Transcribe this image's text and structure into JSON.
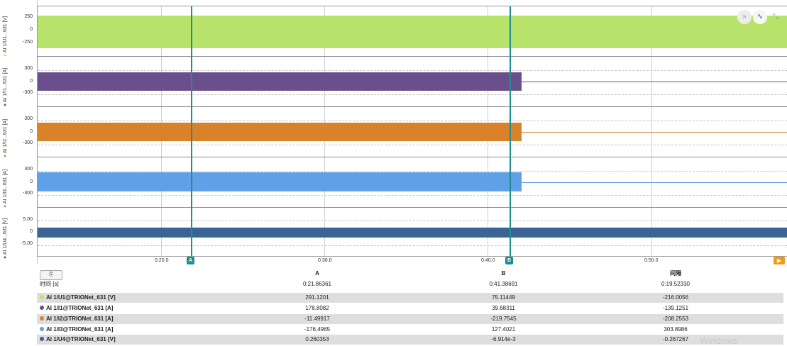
{
  "channels": [
    {
      "axis_label": "AI 1/U1...631 [V]",
      "ticks": [
        "250",
        "0",
        "-250"
      ],
      "color": "#b7e36b"
    },
    {
      "axis_label": "AI 1/I1...631 [A]",
      "ticks": [
        "300",
        "0",
        "-300"
      ],
      "color": "#6a4f8c"
    },
    {
      "axis_label": "AI 1/I2...631 [A]",
      "ticks": [
        "300",
        "0",
        "-300"
      ],
      "color": "#d9822b"
    },
    {
      "axis_label": "AI 1/I3...631 [A]",
      "ticks": [
        "300",
        "0",
        "-300"
      ],
      "color": "#5fa0e6"
    },
    {
      "axis_label": "AI 1/U4...631 [V]",
      "ticks": [
        "5.00",
        "0",
        "-5.00"
      ],
      "color": "#3a6396"
    }
  ],
  "x_ticks": [
    "0:20.0",
    "0:30.0",
    "0:40.0",
    "0:50.0"
  ],
  "cursors": {
    "a": "A",
    "b": "B"
  },
  "toolbar": {
    "forward_icon": "double-chevron-right-icon",
    "curve_icon": "waveform-icon",
    "collapse_icon": "collapse-icon",
    "play_icon": "play-icon"
  },
  "table": {
    "copy_label": "⎘",
    "headers": {
      "a": "A",
      "b": "B",
      "interval": "间隔"
    },
    "time_row": {
      "label": "时间 [s]",
      "a": "0:21.86361",
      "b": "0:41.38691",
      "interval": "0:19.52330"
    },
    "rows": [
      {
        "name": "AI 1/U1@TRIONet_631 [V]",
        "a": "291.1201",
        "b": "75.11449",
        "interval": "-216.0056",
        "color": "#b7e36b"
      },
      {
        "name": "AI 1/I1@TRIONet_631 [A]",
        "a": "178.8082",
        "b": "39.68311",
        "interval": "-139.1251",
        "color": "#6a4f8c"
      },
      {
        "name": "AI 1/I2@TRIONet_631 [A]",
        "a": "-11.49917",
        "b": "-219.7545",
        "interval": "-208.2553",
        "color": "#d9822b"
      },
      {
        "name": "AI 1/I3@TRIONet_631 [A]",
        "a": "-176.4965",
        "b": "127.4021",
        "interval": "303.8986",
        "color": "#5fa0e6"
      },
      {
        "name": "AI 1/U4@TRIONet_631 [V]",
        "a": "0.260353",
        "b": "-6.914e-3",
        "interval": "-0.267267",
        "color": "#3a6396"
      }
    ]
  },
  "watermark": "Windows"
}
